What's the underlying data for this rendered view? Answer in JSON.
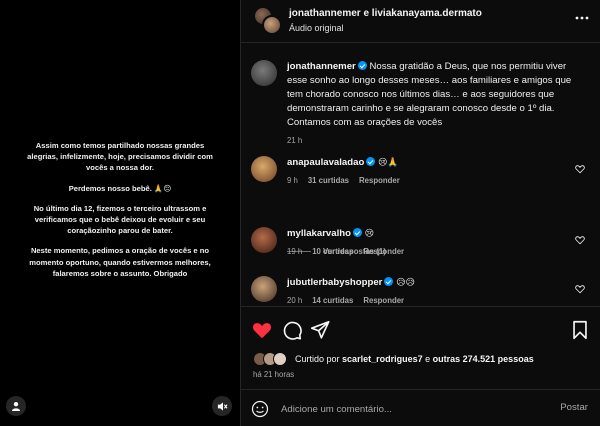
{
  "story": {
    "paragraphs": [
      "Assim como temos partilhado nossas grandes alegrias, infelizmente, hoje, precisamos dividir com vocês a nossa dor.",
      "Perdemos nosso bebê. 🙏😔",
      "No último dia 12, fizemos o terceiro ultrassom e verificamos que o bebê deixou de evoluir e seu coraçãozinho parou de bater.",
      "Neste momento, pedimos a oração de vocês e no momento oportuno, quando estivermos melhores, falaremos sobre o assunto. Obrigado"
    ]
  },
  "header": {
    "title": "jonathannemer e liviakanayama.dermato",
    "subtitle": "Áudio original"
  },
  "caption": {
    "username": "jonathannemer",
    "text": "Nossa gratidão a Deus, que nos permitiu viver esse sonho ao longo desses meses… aos familiares e amigos que tem chorado conosco nos últimos dias… e aos seguidores que demonstraram carinho e se alegraram conosco desde o 1º dia. Contamos com as orações de vocês",
    "time": "21 h"
  },
  "comments": [
    {
      "username": "anapaulavaladao",
      "emojis": "😢🙏",
      "time": "9 h",
      "likes": "31 curtidas",
      "reply": "Responder"
    },
    {
      "username": "myllakarvalho",
      "emojis": "😢",
      "time": "19 h",
      "likes": "10 curtidas",
      "reply": "Responder"
    },
    {
      "username": "jubutlerbabyshopper",
      "emojis": "😥😥",
      "time": "20 h",
      "likes": "14 curtidas",
      "reply": "Responder"
    }
  ],
  "view_replies": "Ver respostas (1)",
  "likes_summary": {
    "prefix": "Curtido por",
    "user": "scarlet_rodrigues7",
    "mid": "e",
    "others": "outras 274.521 pessoas"
  },
  "posted_ago": "há 21 horas",
  "composer": {
    "placeholder": "Adicione um comentário...",
    "post_label": "Postar"
  },
  "colors": {
    "liked_heart": "#ff3040",
    "verified": "#0095f6",
    "background": "#0c0c0c"
  }
}
